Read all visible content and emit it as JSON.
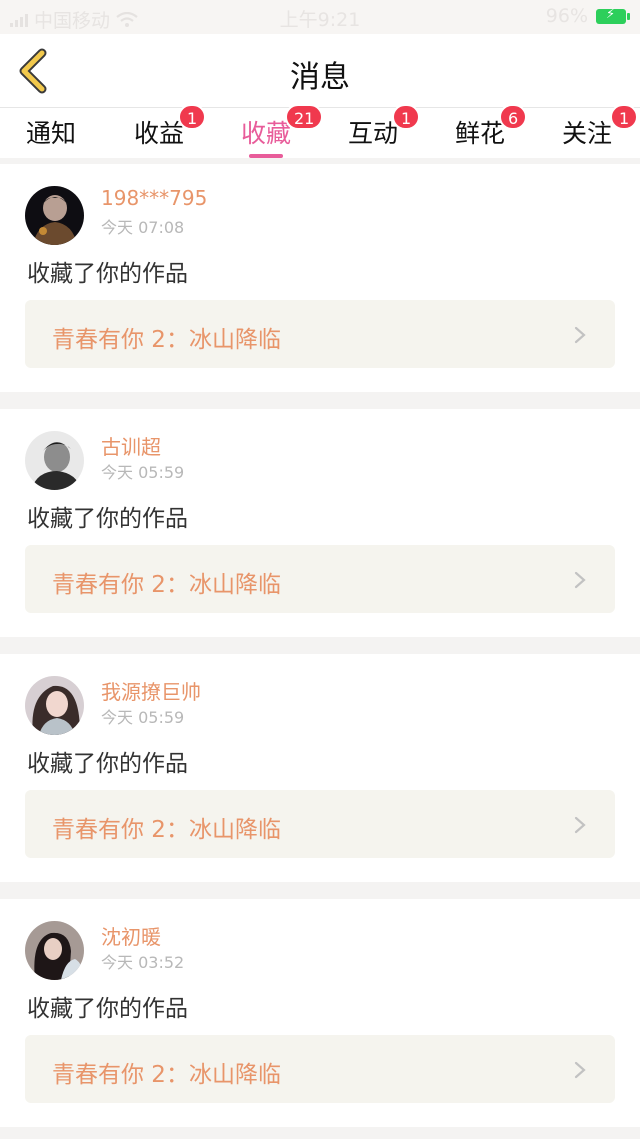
{
  "status_bar": {
    "carrier": "中国移动",
    "time": "上午9:21",
    "battery": "96%"
  },
  "nav": {
    "title": "消息"
  },
  "tabs": [
    {
      "label": "通知",
      "badge": ""
    },
    {
      "label": "收益",
      "badge": "1"
    },
    {
      "label": "收藏",
      "badge": "21",
      "active": true
    },
    {
      "label": "互动",
      "badge": "1"
    },
    {
      "label": "鲜花",
      "badge": "6"
    },
    {
      "label": "关注",
      "badge": "1"
    }
  ],
  "messages": [
    {
      "username": "198***795",
      "time": "今天 07:08",
      "action": "收藏了你的作品",
      "work_title": "青春有你 2：冰山降临"
    },
    {
      "username": "古训超",
      "time": "今天 05:59",
      "action": "收藏了你的作品",
      "work_title": "青春有你 2：冰山降临"
    },
    {
      "username": "我源撩巨帅",
      "time": "今天 05:59",
      "action": "收藏了你的作品",
      "work_title": "青春有你 2：冰山降临"
    },
    {
      "username": "沈初暖",
      "time": "今天 03:52",
      "action": "收藏了你的作品",
      "work_title": "青春有你 2：冰山降临"
    }
  ],
  "colors": {
    "accent_pink": "#e85c9a",
    "name_orange": "#e8956a",
    "badge_red": "#f0394e",
    "back_yellow": "#f2c94c"
  },
  "icons": {
    "back": "chevron-left-icon",
    "row": "chevron-right-icon"
  }
}
